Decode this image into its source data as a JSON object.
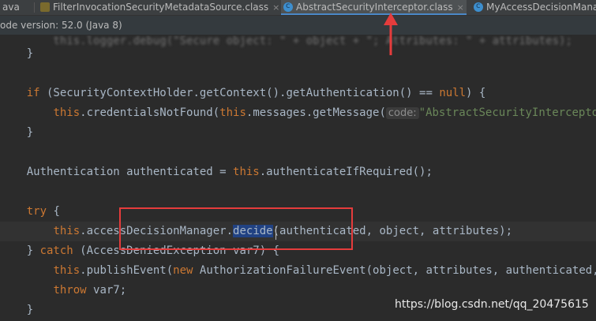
{
  "tabs": [
    {
      "label": "ava",
      "icon": "java-file-icon",
      "active": false
    },
    {
      "label": "FilterInvocationSecurityMetadataSource.class",
      "icon": "class-file-icon",
      "active": false
    },
    {
      "label": "AbstractSecurityInterceptor.class",
      "icon": "class-file-icon",
      "active": true
    },
    {
      "label": "MyAccessDecisionMana",
      "icon": "class-file-icon",
      "active": false
    }
  ],
  "tab_close": "×",
  "notice": "ode version: 52.0 (Java 8)",
  "code": {
    "l1_brace": "}",
    "l2_if": "if",
    "l2_a": " (SecurityContextHolder.getContext().getAuthentication() == ",
    "l2_null": "null",
    "l2_b": ") {",
    "l3_this": "this",
    "l3_a": ".credentialsNotFound(",
    "l3_this2": "this",
    "l3_b": ".messages.getMessage(",
    "l3_hint": "code:",
    "l3_str": "\"AbstractSecurityInterceptor",
    "l4_brace": "}",
    "l5_a": "Authentication authenticated = ",
    "l5_this": "this",
    "l5_b": ".authenticateIfRequired();",
    "l6_try": "try",
    "l6_b": " {",
    "l7_this": "this",
    "l7_a": ".accessDecisionManager.",
    "l7_decide": "decide",
    "l7_b": "(authenticated, object, attributes);",
    "l8_a": "} ",
    "l8_catch": "catch",
    "l8_b": " (AccessDeniedException var7) {",
    "l9_this": "this",
    "l9_a": ".publishEvent(",
    "l9_new": "new",
    "l9_b": " AuthorizationFailureEvent(object, attributes, authenticated, v",
    "l10_throw": "throw",
    "l10_a": " var7;",
    "l11_brace": "}"
  },
  "watermark": "https://blog.csdn.net/qq_20475615",
  "colors": {
    "annotation": "#e53c3c",
    "keyword": "#cc7832",
    "method_highlight": "#214283"
  }
}
